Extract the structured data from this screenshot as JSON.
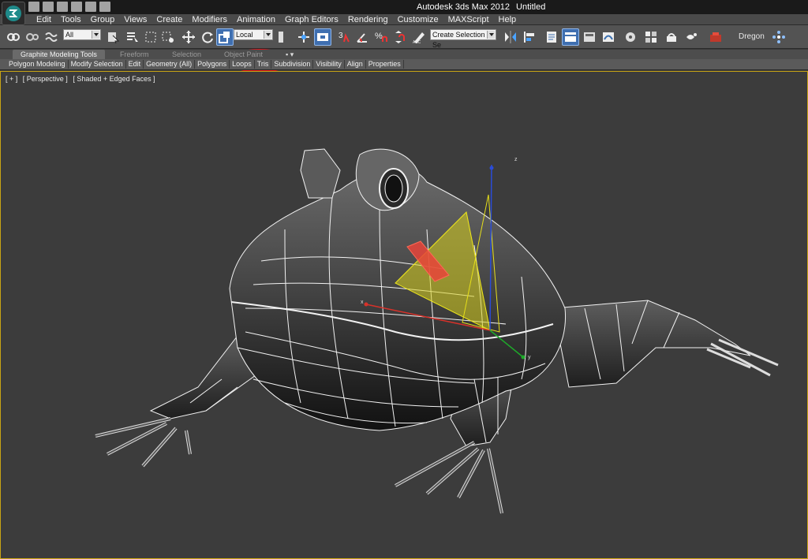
{
  "window": {
    "app_title": "Autodesk 3ds Max  2012",
    "document_title": "Untitled"
  },
  "menu": {
    "items": [
      "Edit",
      "Tools",
      "Group",
      "Views",
      "Create",
      "Modifiers",
      "Animation",
      "Graph Editors",
      "Rendering",
      "Customize",
      "MAXScript",
      "Help"
    ]
  },
  "toolbar": {
    "selection_filter": "All",
    "reference_coordinate_system": "Local",
    "named_selection_set": "Create Selection Se",
    "snaps_label": "3",
    "angle_snap_label": "",
    "percent_snap_label": "%",
    "workspace_label": "Dregon"
  },
  "ribbon": {
    "tabs": [
      "Graphite Modeling Tools",
      "Freeform",
      "Selection",
      "Object Paint"
    ],
    "active_tab": "Graphite Modeling Tools",
    "panels": [
      "Polygon Modeling",
      "Modify Selection",
      "Edit",
      "Geometry (All)",
      "Polygons",
      "Loops",
      "Tris",
      "Subdivision",
      "Visibility",
      "Align",
      "Properties"
    ]
  },
  "viewport": {
    "menu_plus": "[ + ]",
    "view_name": "[ Perspective ]",
    "shading_mode": "[ Shaded + Edged Faces ]",
    "gizmo_axes": {
      "x": "x",
      "y": "y",
      "z": "z"
    }
  },
  "colors": {
    "highlight_circle": "#e0141b",
    "active_border": "#c8a414",
    "selected_face": "#e8443a",
    "gizmo_plane": "#d8d21e"
  }
}
